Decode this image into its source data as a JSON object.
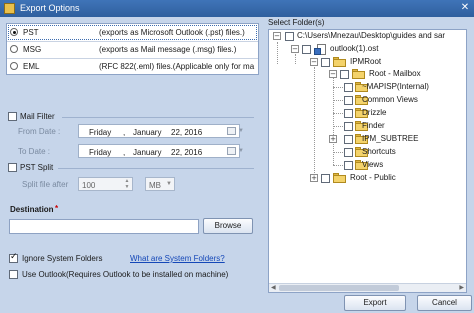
{
  "window": {
    "title": "Export Options",
    "close_glyph": "✕"
  },
  "formats": [
    {
      "name": "PST",
      "desc": "(exports as Microsoft Outlook (.pst) files.)",
      "selected": true
    },
    {
      "name": "MSG",
      "desc": "(exports as Mail message (.msg) files.)",
      "selected": false
    },
    {
      "name": "EML",
      "desc": "(RFC 822(.eml) files.(Applicable only for ma",
      "selected": false
    }
  ],
  "mail_filter": {
    "label": "Mail Filter",
    "checked": false,
    "from_label": "From Date :",
    "to_label": "To Date :",
    "from": {
      "day": "Friday",
      "sep": ",",
      "month": "January",
      "date": "22, 2016"
    },
    "to": {
      "day": "Friday",
      "sep": ",",
      "month": "January",
      "date": "22, 2016"
    }
  },
  "pst_split": {
    "label": "PST Split",
    "checked": false,
    "size_label": "Split file after",
    "size_value": "100",
    "unit": "MB"
  },
  "destination": {
    "label": "Destination",
    "required_mark": "*",
    "value": "",
    "browse_label": "Browse"
  },
  "options": {
    "ignore_system_folders_label": "Ignore System Folders",
    "ignore_system_folders_checked": true,
    "what_are_system_folders_link": "What are System Folders?",
    "use_outlook_label": "Use Outlook(Requires Outlook to be installed on machine)",
    "use_outlook_checked": false
  },
  "folders": {
    "header": "Select Folder(s)",
    "tree": [
      {
        "label": "C:\\Users\\Mnezau\\Desktop\\guides and sar",
        "expander": "−",
        "checkbox": true,
        "icon": "none"
      },
      {
        "label": "outlook(1).ost",
        "expander": "−",
        "checkbox": true,
        "icon": "pst-file-icon"
      },
      {
        "label": "IPMRoot",
        "expander": "−",
        "checkbox": true,
        "icon": "folder-icon"
      },
      {
        "label": "Root - Mailbox",
        "expander": "−",
        "checkbox": true,
        "icon": "folder-icon"
      },
      {
        "label": "~MAPISP(Internal)",
        "expander": "",
        "checkbox": true,
        "icon": "folder-icon"
      },
      {
        "label": "Common Views",
        "expander": "",
        "checkbox": true,
        "icon": "folder-icon"
      },
      {
        "label": "Drizzle",
        "expander": "",
        "checkbox": true,
        "icon": "folder-icon"
      },
      {
        "label": "Finder",
        "expander": "",
        "checkbox": true,
        "icon": "folder-icon"
      },
      {
        "label": "IPM_SUBTREE",
        "expander": "+",
        "checkbox": true,
        "icon": "folder-icon"
      },
      {
        "label": "Shortcuts",
        "expander": "",
        "checkbox": true,
        "icon": "folder-icon"
      },
      {
        "label": "Views",
        "expander": "",
        "checkbox": true,
        "icon": "folder-icon"
      },
      {
        "label": "Root - Public",
        "expander": "+",
        "checkbox": true,
        "icon": "folder-icon"
      }
    ]
  },
  "footer": {
    "export_label": "Export",
    "cancel_label": "Cancel"
  },
  "colors": {
    "title_bar": "#2f5f9e",
    "background": "#c6d5ea",
    "link": "#1447b8"
  }
}
